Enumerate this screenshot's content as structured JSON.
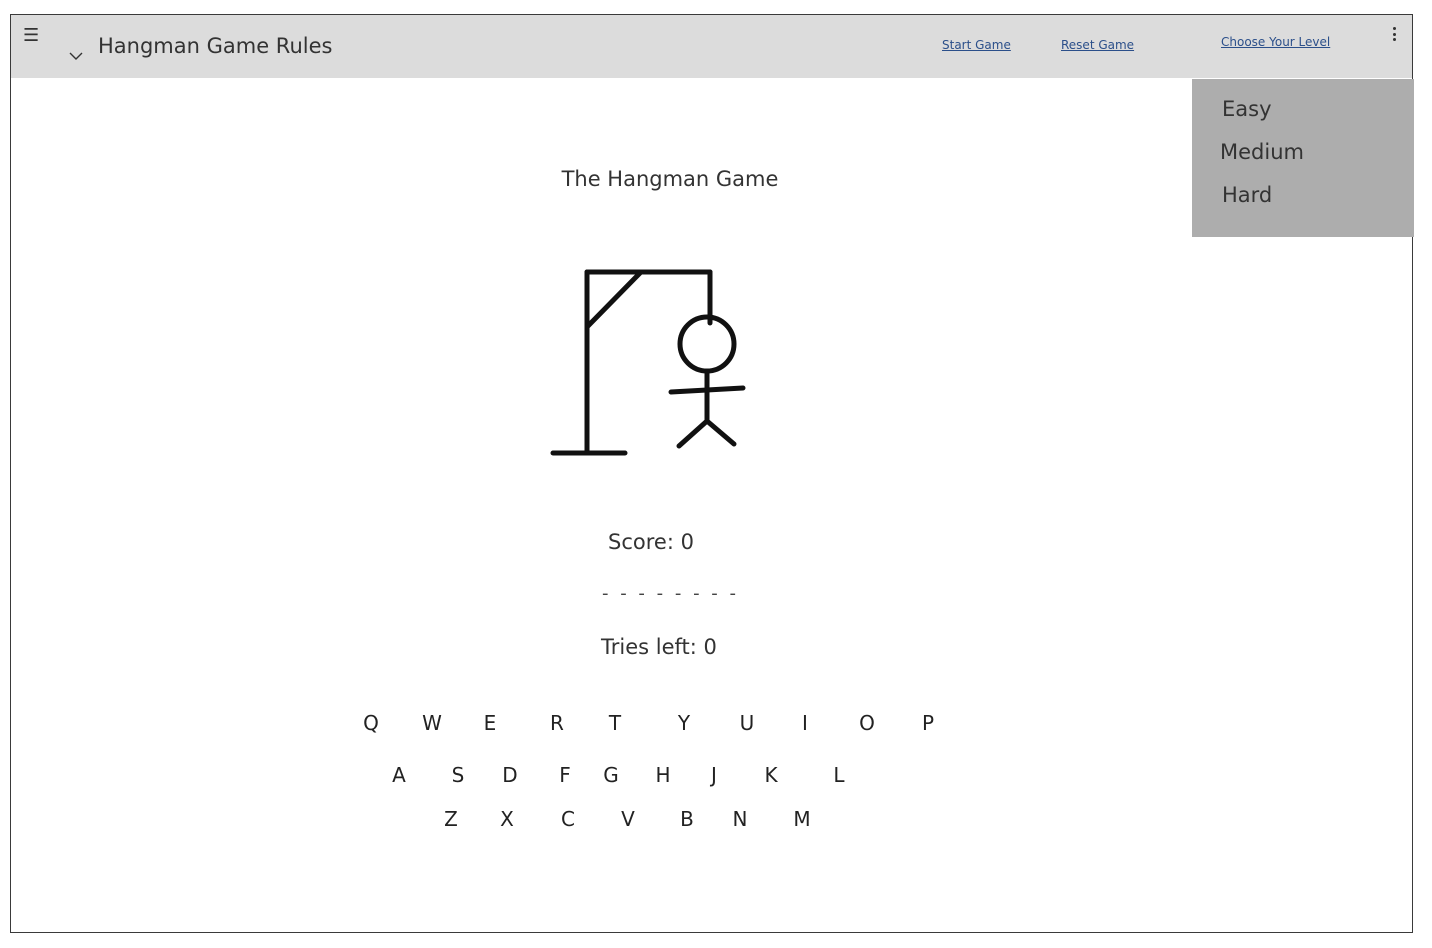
{
  "header": {
    "menu_icon": "hamburger-icon",
    "chevron_icon": "chevron-down-icon",
    "title": "Hangman Game Rules",
    "links": {
      "start": "Start Game",
      "reset": "Reset Game",
      "level": "Choose Your Level"
    },
    "more_icon": "kebab-menu-icon"
  },
  "level_menu": {
    "items": [
      "Easy",
      "Medium",
      "Hard"
    ]
  },
  "game": {
    "title": "The Hangman Game",
    "illustration": "gallows-stick-figure",
    "score": "Score: 0",
    "word_blanks": "- - - - - - - -",
    "tries_left": "Tries left: 0"
  },
  "keyboard": {
    "row1": [
      "Q",
      "W",
      "E",
      "R",
      "T",
      "Y",
      "U",
      "I",
      "O",
      "P"
    ],
    "row2": [
      "A",
      "S",
      "D",
      "F",
      "G",
      "H",
      "J",
      "K",
      "L"
    ],
    "row3": [
      "Z",
      "X",
      "C",
      "V",
      "B",
      "N",
      "M"
    ]
  }
}
